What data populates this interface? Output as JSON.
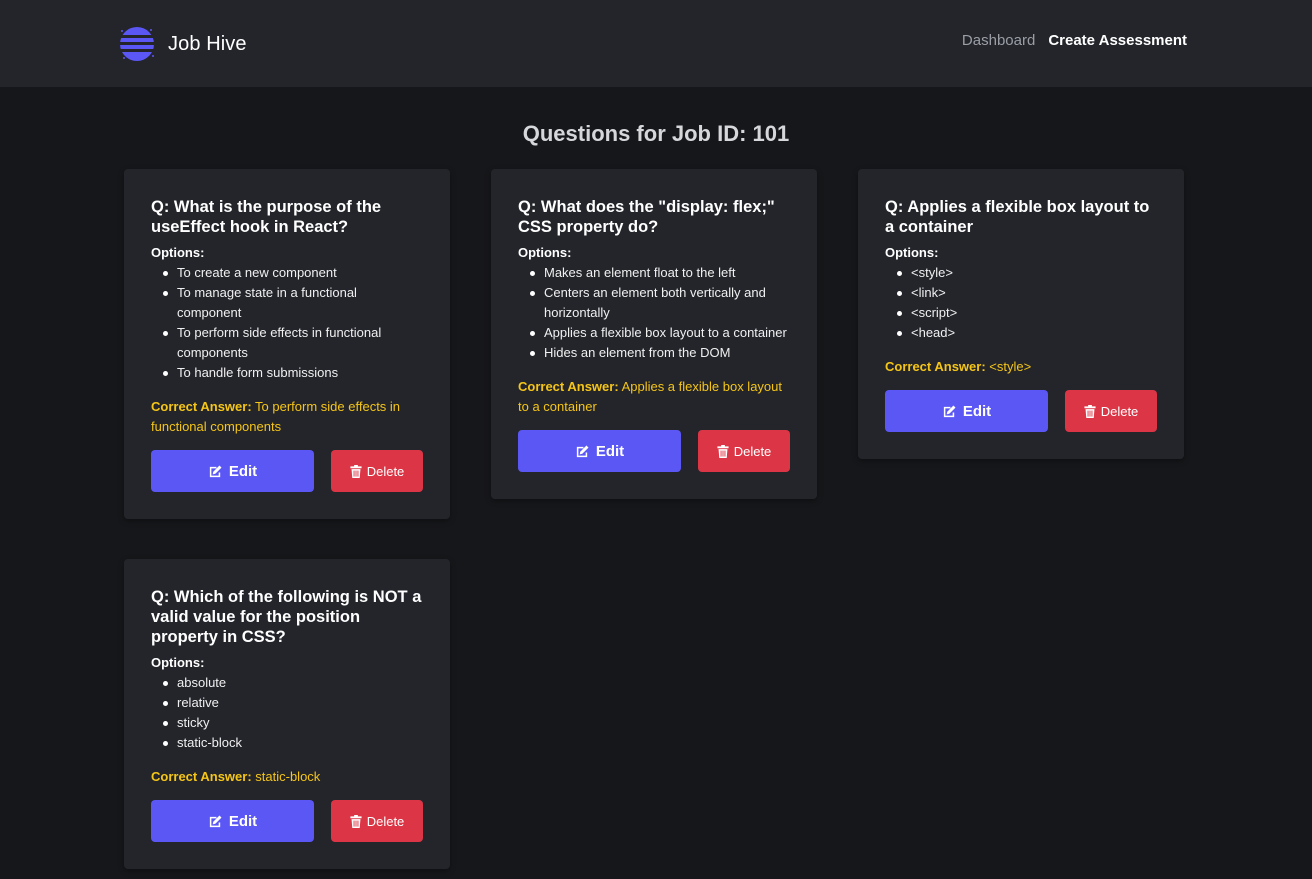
{
  "navbar": {
    "brand_name": "Job Hive",
    "links": [
      "Dashboard",
      "Create Assessment"
    ]
  },
  "page": {
    "title": "Questions for Job ID: 101"
  },
  "colors": {
    "accent": "#5b57f5",
    "danger": "#dc3545",
    "answer": "#f5c518",
    "card_bg": "#23252b",
    "page_bg": "#16171a"
  },
  "labels": {
    "options": "Options:",
    "correct_answer": "Correct Answer:",
    "edit": "Edit",
    "delete": "Delete"
  },
  "questions": [
    {
      "question": "Q: What is the purpose of the useEffect hook in React?",
      "options": [
        "To create a new component",
        "To manage state in a functional component",
        "To perform side effects in functional components",
        "To handle form submissions"
      ],
      "correct_answer": "To perform side effects in functional components"
    },
    {
      "question": "Q: What does the \"display: flex;\" CSS property do?",
      "options": [
        "Makes an element float to the left",
        "Centers an element both vertically and horizontally",
        "Applies a flexible box layout to a container",
        "Hides an element from the DOM"
      ],
      "correct_answer": "Applies a flexible box layout to a container"
    },
    {
      "question": "Q: Applies a flexible box layout to a container",
      "options": [
        "<style>",
        "<link>",
        "<script>",
        "<head>"
      ],
      "correct_answer": "<style>"
    },
    {
      "question": "Q: Which of the following is NOT a valid value for the position property in CSS?",
      "options": [
        "absolute",
        "relative",
        "sticky",
        "static-block"
      ],
      "correct_answer": "static-block"
    }
  ]
}
